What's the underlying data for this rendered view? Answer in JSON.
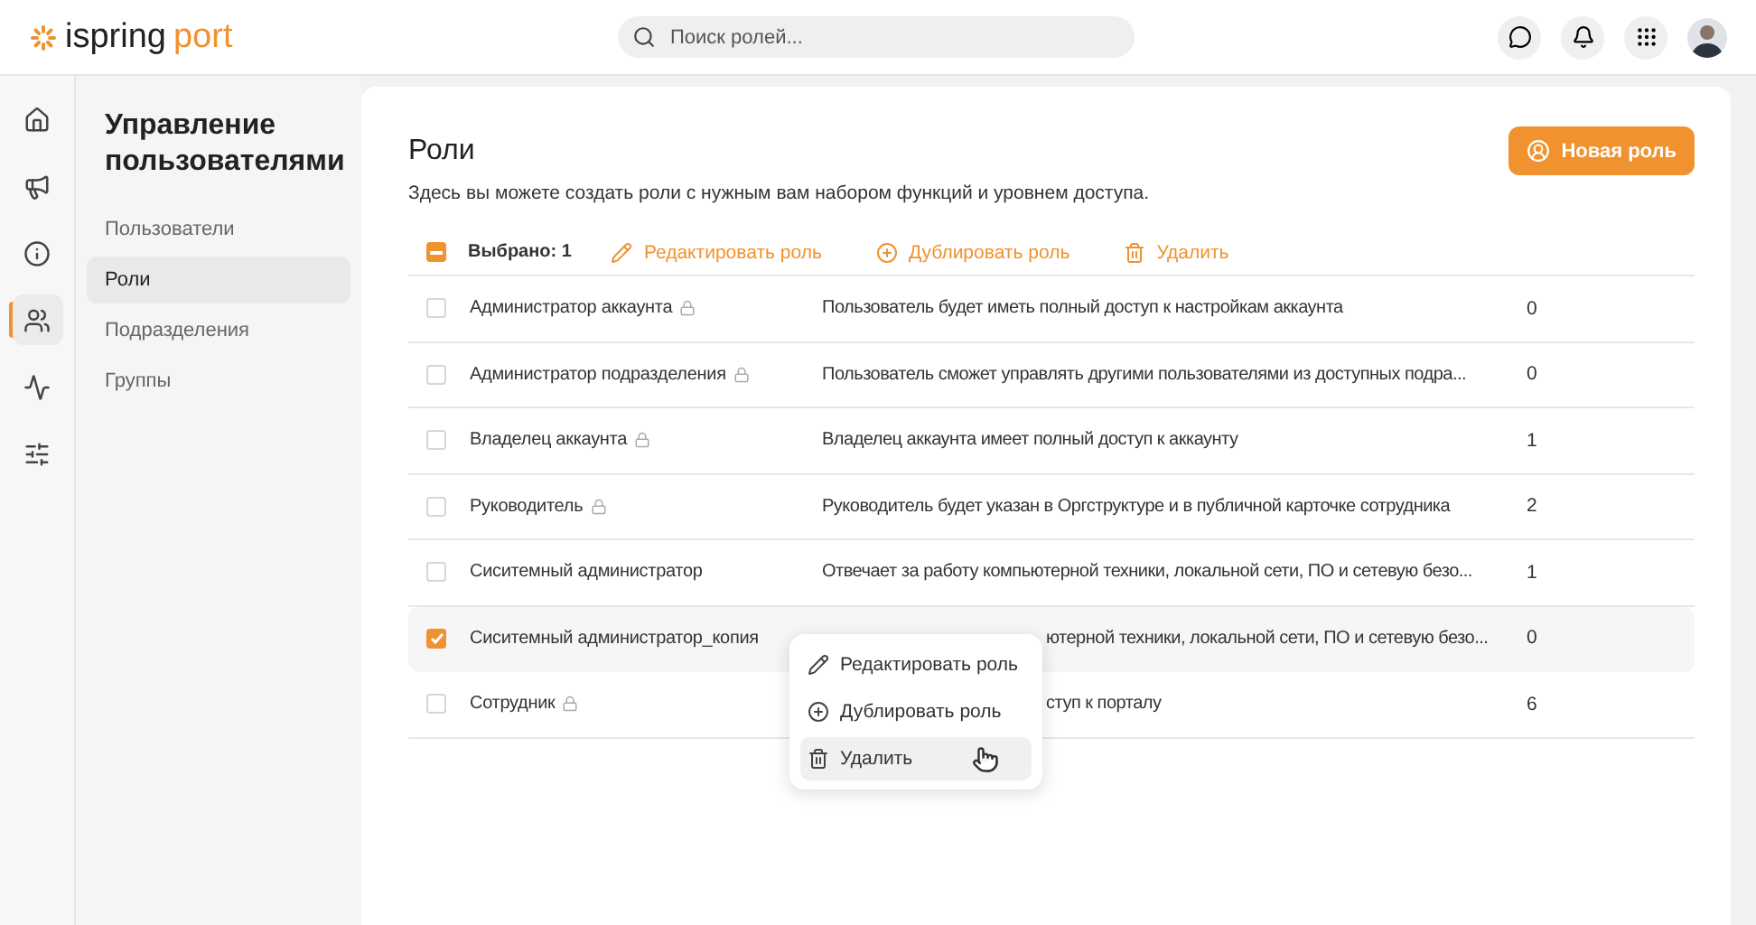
{
  "logo": {
    "part_1": "ispring",
    "part_2": "port"
  },
  "search": {
    "placeholder": "Поиск ролей..."
  },
  "rail": [
    {
      "selected": false
    },
    {
      "selected": false
    },
    {
      "selected": false
    },
    {
      "selected": true
    },
    {
      "selected": false
    },
    {
      "selected": false
    }
  ],
  "submenu": {
    "title": "Управление пользователями",
    "items": [
      {
        "label": "Пользователи",
        "selected": false
      },
      {
        "label": "Роли",
        "selected": true
      },
      {
        "label": "Подразделения",
        "selected": false
      },
      {
        "label": "Группы",
        "selected": false
      }
    ]
  },
  "page": {
    "title": "Роли",
    "subtitle": "Здесь вы можете создать роли с нужным вам набором функций и уровнем доступа.",
    "new_button": "Новая роль"
  },
  "toolbar": {
    "select_all_indeterminate": true,
    "selected_count": "Выбрано: 1",
    "actions": [
      {
        "kind": "edit",
        "label": "Редактировать роль"
      },
      {
        "kind": "duplicate",
        "label": "Дублировать роль"
      },
      {
        "kind": "delete",
        "label": "Удалить"
      }
    ]
  },
  "rows": [
    {
      "name": "Администратор аккаунта",
      "locked": true,
      "description": "Пользователь будет иметь полный доступ к настройкам аккаунта",
      "partly_hidden": false,
      "count": "0",
      "checked": false
    },
    {
      "name": "Администратор подразделения",
      "locked": true,
      "description": "Пользователь сможет управлять другими пользователями из доступных подра...",
      "partly_hidden": false,
      "count": "0",
      "checked": false
    },
    {
      "name": "Владелец аккаунта",
      "locked": true,
      "description": "Владелец аккаунта имеет полный доступ к аккаунту",
      "partly_hidden": false,
      "count": "1",
      "checked": false
    },
    {
      "name": "Руководитель",
      "locked": true,
      "description": "Руководитель будет указан в Оргструктуре и в публичной карточке сотрудника",
      "partly_hidden": false,
      "count": "2",
      "checked": false
    },
    {
      "name": "Сиситемный администратор",
      "locked": false,
      "description": "Отвечает за работу компьютерной техники, локальной сети, ПО и сетевую безо...",
      "partly_hidden": false,
      "count": "1",
      "checked": false
    },
    {
      "name": "Сиситемный администратор_копия",
      "locked": false,
      "description": "ютерной техники, локальной сети, ПО и сетевую безо...",
      "partly_hidden": true,
      "count": "0",
      "checked": true
    },
    {
      "name": "Сотрудник",
      "locked": true,
      "description": "ступ к порталу",
      "partly_hidden": true,
      "count": "6",
      "checked": false
    }
  ],
  "context_menu": {
    "items": [
      {
        "kind": "edit",
        "label": "Редактировать роль",
        "hovered": false
      },
      {
        "kind": "duplicate",
        "label": "Дублировать роль",
        "hovered": false
      },
      {
        "kind": "delete",
        "label": "Удалить",
        "hovered": true
      }
    ]
  }
}
